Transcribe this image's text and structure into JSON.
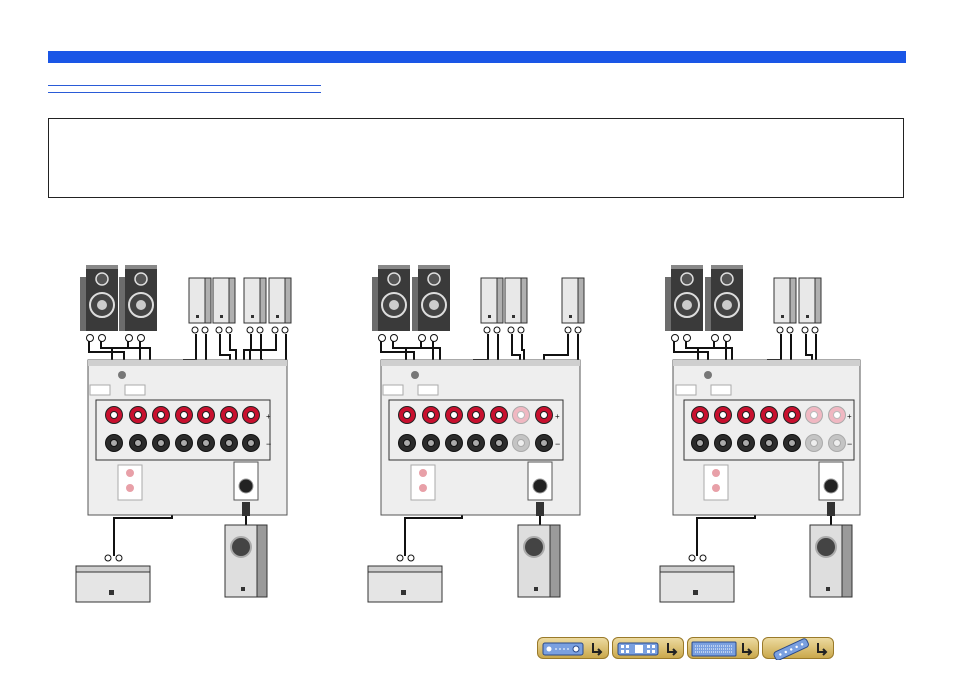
{
  "header": {
    "bar_color": "#1a56e6"
  },
  "diagrams": [
    {
      "id": "diagram-7-1",
      "surround_pairs": 2,
      "active_columns": 7
    },
    {
      "id": "diagram-6-1",
      "surround_pairs": 1,
      "active_columns": 6
    },
    {
      "id": "diagram-5-1",
      "surround_pairs": 0,
      "active_columns": 5
    }
  ],
  "terminal_signs": {
    "plus": "+",
    "minus": "−"
  },
  "navigation": {
    "buttons": [
      {
        "name": "front-panel",
        "icon": "front-panel-icon"
      },
      {
        "name": "rear-panel",
        "icon": "rear-panel-icon"
      },
      {
        "name": "display",
        "icon": "display-icon"
      },
      {
        "name": "remote",
        "icon": "remote-control-icon"
      }
    ],
    "arrow_icon": "return-arrow-icon"
  },
  "colors": {
    "terminal_red": "#c8102e",
    "terminal_black": "#2b2b2b",
    "cable": "#111111",
    "accent": "#1a56e6"
  }
}
